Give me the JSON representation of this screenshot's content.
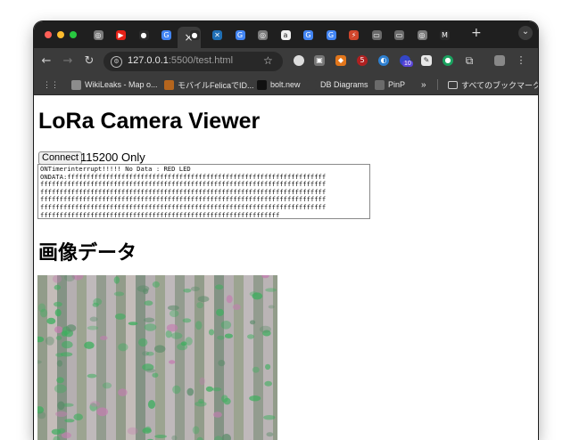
{
  "window": {
    "active_tab_close": "×",
    "new_tab": "+",
    "tab_list": "⌄"
  },
  "tabs": [
    {
      "icon": "chatgpt-icon",
      "color": "#7a7a7a",
      "glyph": "◎"
    },
    {
      "icon": "youtube-icon",
      "color": "#e62117",
      "glyph": "▶"
    },
    {
      "icon": "github-icon",
      "color": "#2b2b2b",
      "glyph": "●"
    },
    {
      "icon": "google-icon",
      "color": "#4285f4",
      "glyph": "G"
    },
    {
      "icon": "github-icon",
      "color": "#2b2b2b",
      "glyph": "●"
    },
    {
      "icon": "x-icon",
      "color": "#1f6fb5",
      "glyph": "✕"
    },
    {
      "icon": "google-icon",
      "color": "#4285f4",
      "glyph": "G"
    },
    {
      "icon": "chatgpt-icon",
      "color": "#7a7a7a",
      "glyph": "◎"
    },
    {
      "icon": "amazon-icon",
      "color": "#f0f0f0",
      "glyph": "a"
    },
    {
      "icon": "google-icon",
      "color": "#4285f4",
      "glyph": "G"
    },
    {
      "icon": "google-icon",
      "color": "#4285f4",
      "glyph": "G"
    },
    {
      "icon": "flame-icon",
      "color": "#d0452b",
      "glyph": "⚡"
    },
    {
      "icon": "chip-icon",
      "color": "#6a6a6a",
      "glyph": "▭"
    },
    {
      "icon": "chip-icon",
      "color": "#6a6a6a",
      "glyph": "▭"
    },
    {
      "icon": "chatgpt-icon",
      "color": "#7a7a7a",
      "glyph": "◎"
    },
    {
      "icon": "m-icon",
      "color": "#2b2b2b",
      "glyph": "M"
    }
  ],
  "toolbar": {
    "back": "←",
    "forward": "→",
    "reload": "↻",
    "url_host": "127.0.0.1",
    "url_path": ":5500/test.html",
    "bookmark_star": "☆",
    "badge_count": "10"
  },
  "bookmarks": {
    "apps": "⋮⋮",
    "items": [
      {
        "label": "WikiLeaks - Map o...",
        "icon": "wikileaks-icon",
        "color": "#8c8c8c"
      },
      {
        "label": "モバイルFelicaでID...",
        "icon": "avatar-icon",
        "color": "#b5651d"
      },
      {
        "label": "bolt.new",
        "icon": "bolt-icon",
        "color": "#111111"
      },
      {
        "label": "DB Diagrams",
        "icon": "dbdiagram-icon",
        "color": "#3b3b3b"
      },
      {
        "label": "PinP",
        "icon": "globe-icon",
        "color": "#6b6b6b"
      }
    ],
    "more": "»",
    "all_bookmarks": "すべてのブックマーク"
  },
  "page": {
    "title": "LoRa Camera Viewer",
    "connect_label": "Connect",
    "baud_label": "115200 Only",
    "log_lines": [
      "ONTimerinterrupt!!!!! No Data : RED LED",
      "ONDATA:fffffffffffffffffffffffffffffffffffffffffffffffffffffffffffffffffff",
      "ffffffffffffffffffffffffffffffffffffffffffffffffffffffffffffffffffffffffff",
      "ffffffffffffffffffffffffffffffffffffffffffffffffffffffffffffffffffffffffff",
      "ffffffffffffffffffffffffffffffffffffffffffffffffffffffffffffffffffffffffff",
      "ffffffffffffffffffffffffffffffffffffffffffffffffffffffffffffffffffffffffff",
      "ffffffffffffffffffffffffffffffffffffffffffffffffffffffffffffff"
    ],
    "image_heading": "画像データ"
  }
}
